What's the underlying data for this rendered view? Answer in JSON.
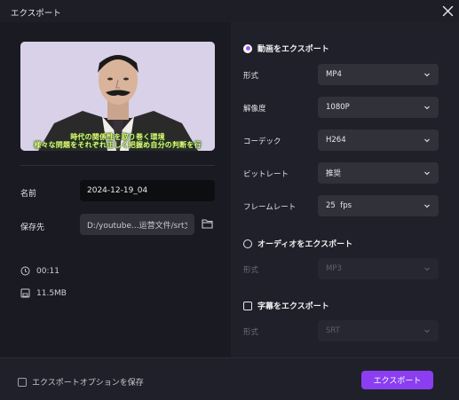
{
  "window": {
    "title": "エクスポート"
  },
  "preview": {
    "caption_line1": "時代の関係性を取り巻く環境",
    "caption_line2": "様々な問題をそれぞれ正しく把握め自分の判断を行"
  },
  "file": {
    "name_label": "名前",
    "name_value": "2024-12-19_04",
    "save_label": "保存先",
    "save_path": "D:/youtube...运营文件/srt文件",
    "duration": "00:11",
    "size": "11.5MB"
  },
  "video_export": {
    "heading": "動画をエクスポート",
    "format_label": "形式",
    "format_value": "MP4",
    "resolution_label": "解像度",
    "resolution_value": "1080P",
    "codec_label": "コーデック",
    "codec_value": "H264",
    "bitrate_label": "ビットレート",
    "bitrate_value": "推奨",
    "framerate_label": "フレームレート",
    "framerate_value": "25  fps"
  },
  "audio_export": {
    "heading": "オーディオをエクスポート",
    "format_label": "形式",
    "format_value": "MP3"
  },
  "subtitle_export": {
    "heading": "字幕をエクスポート",
    "format_label": "形式",
    "format_value": "SRT"
  },
  "footer": {
    "save_options_label": "エクスポートオプションを保存",
    "export_button": "エクスポート"
  },
  "colors": {
    "accent": "#8a3ef0",
    "background": "#1f2029"
  }
}
